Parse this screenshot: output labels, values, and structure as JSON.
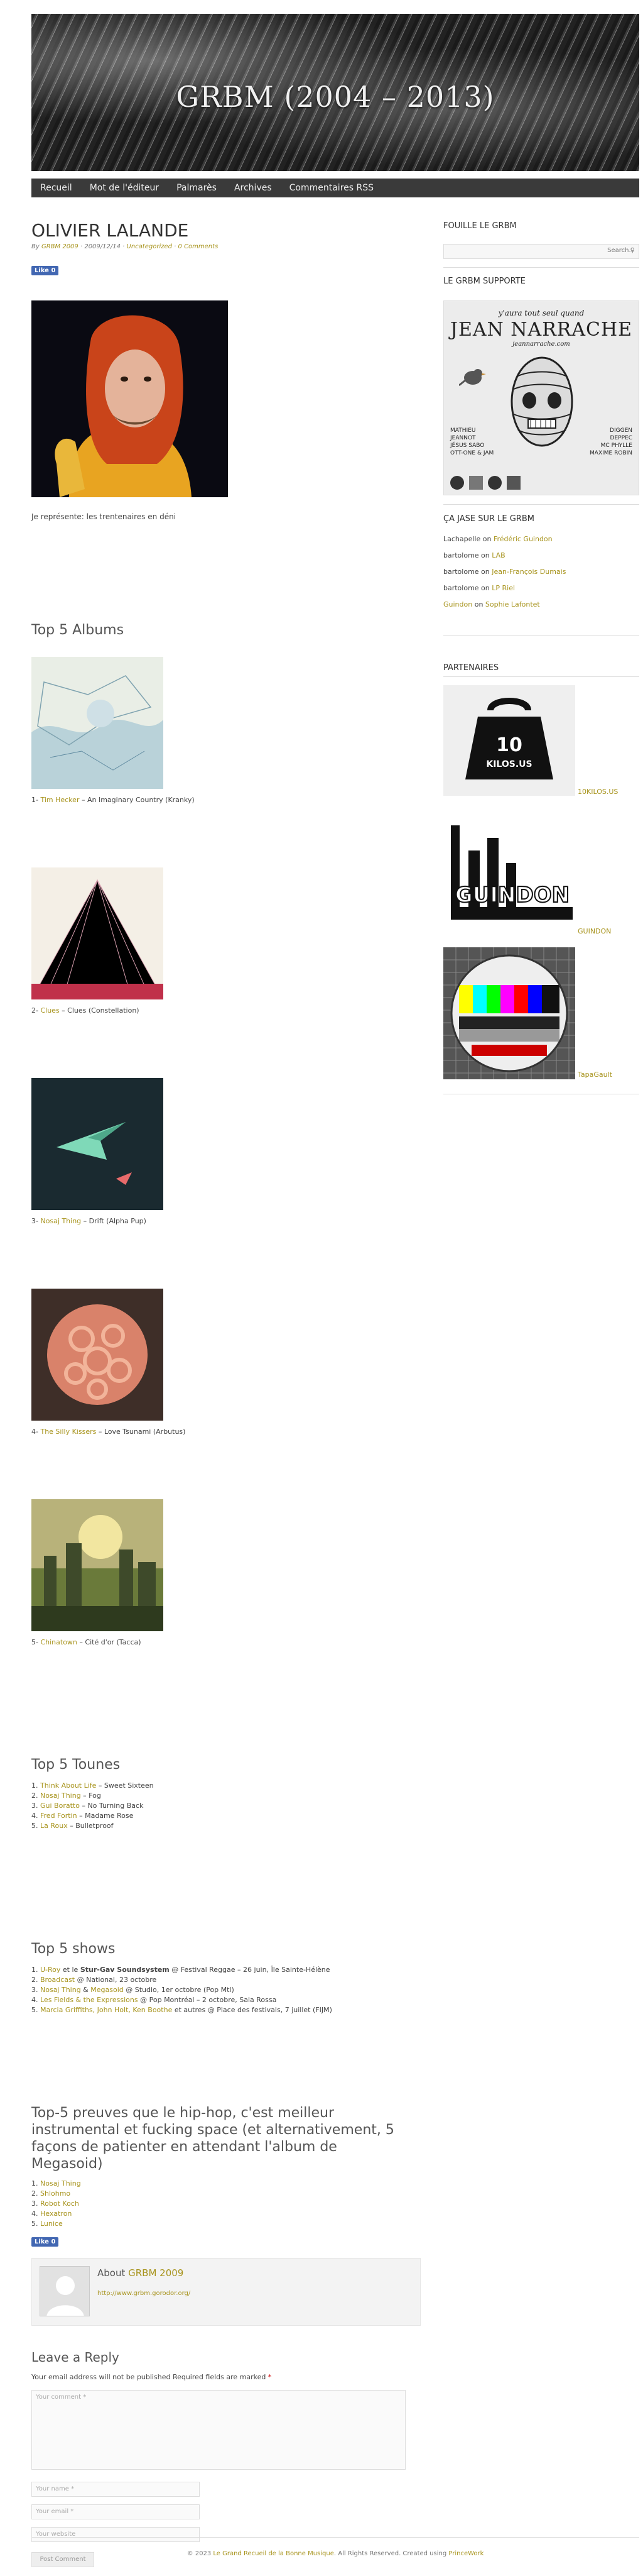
{
  "site_title": "GRBM (2004 – 2013)",
  "nav": [
    "Recueil",
    "Mot de l'éditeur",
    "Palmarès",
    "Archives",
    "Commentaires RSS"
  ],
  "post": {
    "title": "OLIVIER LALANDE",
    "meta_by": "By",
    "meta_author": "GRBM 2009",
    "meta_date": " · 2009/12/14 · ",
    "meta_cat": "Uncategorized",
    "meta_sep": " · ",
    "meta_comments": "0 Comments",
    "like": "Like 0",
    "intro": "Je représente: les trentenaires en déni"
  },
  "albums": {
    "heading": "Top 5 Albums",
    "items": [
      {
        "num": "1- ",
        "artist": "Tim Hecker",
        "rest": " – An Imaginary Country (Kranky)"
      },
      {
        "num": "2- ",
        "artist": "Clues",
        "rest": " – Clues (Constellation)"
      },
      {
        "num": "3- ",
        "artist": "Nosaj Thing",
        "rest": " – Drift (Alpha Pup)"
      },
      {
        "num": "4- ",
        "artist": "The Silly Kissers",
        "rest": " – Love Tsunami (Arbutus)"
      },
      {
        "num": "5- ",
        "artist": "Chinatown",
        "rest": " – Cité d'or (Tacca)"
      }
    ]
  },
  "tounes": {
    "heading": "Top 5 Tounes",
    "items": [
      {
        "num": "1. ",
        "artist": "Think About Life",
        "rest": " – Sweet Sixteen"
      },
      {
        "num": "2. ",
        "artist": "Nosaj Thing",
        "rest": " – Fog"
      },
      {
        "num": "3. ",
        "artist": "Gui Boratto",
        "rest": " – No Turning Back"
      },
      {
        "num": "4. ",
        "artist": "Fred Fortin",
        "rest": " – Madame Rose"
      },
      {
        "num": "5. ",
        "artist": "La Roux",
        "rest": " – Bulletproof"
      }
    ]
  },
  "shows": {
    "heading": "Top 5 shows",
    "items": [
      {
        "num": "1. ",
        "a": "U-Roy",
        "mid": " et le ",
        "b": "Stur-Gav Soundsystem",
        "rest": " @ Festival Reggae – 26 juin, Île Sainte-Hélène"
      },
      {
        "num": "2. ",
        "a": "Broadcast",
        "mid": "",
        "b": "",
        "rest": " @ National, 23 octobre"
      },
      {
        "num": "3. ",
        "a": "Nosaj Thing",
        "mid": " & ",
        "b": "Megasoid",
        "rest": " @ Studio, 1er octobre (Pop Mtl)"
      },
      {
        "num": "4. ",
        "a": "Les Fields & the Expressions",
        "mid": "",
        "b": "",
        "rest": " @ Pop Montréal – 2 octobre, Sala Rossa"
      },
      {
        "num": "5. ",
        "a": "Marcia Griffiths, John Holt, Ken Boothe",
        "mid": "",
        "b": "",
        "rest": " et autres @ Place des festivals, 7 juillet (FIJM)"
      }
    ]
  },
  "hiphop": {
    "heading": "Top-5 preuves que le hip-hop, c'est meilleur instrumental et fucking space (et alternativement, 5 façons de patienter en attendant l'album de Megasoid)",
    "items": [
      {
        "num": "1. ",
        "artist": "Nosaj Thing"
      },
      {
        "num": "2. ",
        "artist": "Shlohmo"
      },
      {
        "num": "3. ",
        "artist": "Robot Koch"
      },
      {
        "num": "4. ",
        "artist": "Hexatron"
      },
      {
        "num": "5. ",
        "artist": "Lunice"
      }
    ]
  },
  "author_box": {
    "about": "About ",
    "name": "GRBM 2009",
    "url": "http://www.grbm.gorodor.org/"
  },
  "reply": {
    "heading": "Leave a Reply",
    "note": "Your email address will not be published Required fields are marked ",
    "star": "*",
    "comment_ph": "Your comment *",
    "name_ph": "Your name *",
    "email_ph": "Your email *",
    "website_ph": "Your website",
    "submit": "Post Comment"
  },
  "sidebar": {
    "fouille": "FOUILLE LE GRBM",
    "search_ph": "Search...",
    "supporte": "LE GRBM SUPPORTE",
    "poster": {
      "top": "y'aura tout seul quand",
      "name": "JEAN NARRACHE",
      "url": "jeannarrache.com",
      "left": "MATHIEU\nJEANNOT\nJÉSUS SABO\nOTT-ONE & JAM",
      "right": "DIGGEN\nDEPPEC\nMC PHYLLE\nMAXIME ROBIN"
    },
    "jase": "ÇA JASE SUR LE GRBM",
    "comments": [
      {
        "who": "Lachapelle",
        "on": " on ",
        "what": "Frédéric Guindon"
      },
      {
        "who": "bartolome",
        "on": " on ",
        "what": "LAB"
      },
      {
        "who": "bartolome",
        "on": " on ",
        "what": "Jean-François Dumais"
      },
      {
        "who": "bartolome",
        "on": " on ",
        "what": "LP Riel"
      },
      {
        "who": "Guindon",
        "on": " on ",
        "what": "Sophie Lafontet"
      }
    ],
    "partenaires": "PARTENAIRES",
    "partners": [
      {
        "label": "10KILOS.US",
        "logo_text": "10 KILOS.US"
      },
      {
        "label": "GUINDON",
        "logo_text": "GUINDON"
      },
      {
        "label": "TapaGault",
        "logo_text": ""
      }
    ]
  },
  "footer": {
    "pre": "© 2023 ",
    "link1": "Le Grand Recueil de la Bonne Musique",
    "mid": ". All Rights Reserved. Created using ",
    "link2": "PrinceWork"
  },
  "colors": {
    "accent": "#a8941e",
    "nav_bg": "#3a3a3a"
  }
}
